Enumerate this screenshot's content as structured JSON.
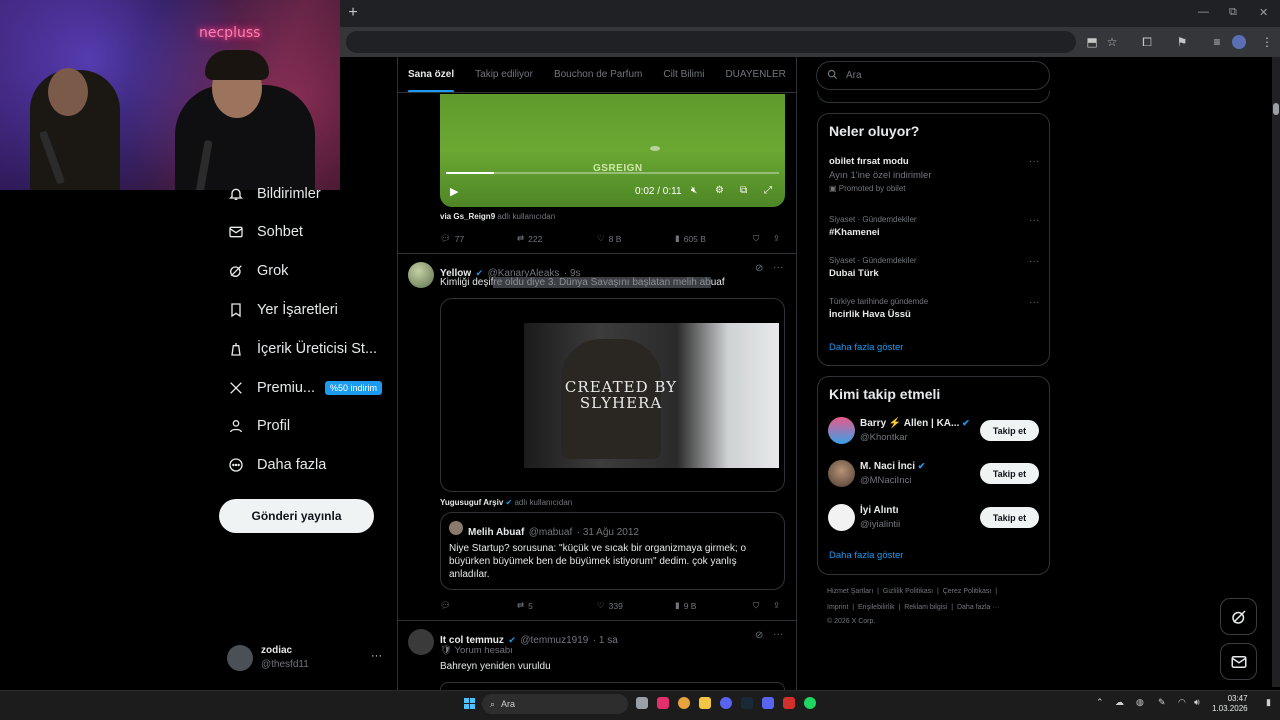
{
  "window": {
    "newtab": "+",
    "minimize": "—",
    "maximize": "⧉",
    "close": "✕"
  },
  "overlay": {
    "neon_text": "necpluss"
  },
  "nav": {
    "items": [
      {
        "label": "Bildirimler",
        "icon": "bell-icon"
      },
      {
        "label": "Sohbet",
        "icon": "mail-icon"
      },
      {
        "label": "Grok",
        "icon": "grok-icon"
      },
      {
        "label": "Yer İşaretleri",
        "icon": "bookmark-icon"
      },
      {
        "label": "İçerik Üreticisi St...",
        "icon": "creator-studio-icon"
      },
      {
        "label": "Premiu...",
        "icon": "x-logo-icon",
        "badge": "%50 indirim"
      },
      {
        "label": "Profil",
        "icon": "person-icon"
      },
      {
        "label": "Daha fazla",
        "icon": "more-circle-icon"
      }
    ],
    "post_button": "Gönderi yayınla",
    "account": {
      "name": "zodiac",
      "handle": "@thesfd11",
      "more": "···"
    }
  },
  "feed": {
    "tabs": [
      "Sana özel",
      "Takip ediliyor",
      "Bouchon de Parfum",
      "Cilt Bilimi",
      "DUAYENLER"
    ],
    "active_tab": 0,
    "post1": {
      "video_overlay_text": "GSREIGN",
      "time": "0:02 / 0:11",
      "via_user": "via Gs_Reign9",
      "via_suffix": "adlı kullanıcıdan",
      "replies": "77",
      "reposts": "222",
      "likes": "8 B",
      "views": "605 B"
    },
    "post2": {
      "name": "Yellow",
      "handle": "@KanaryAleaks",
      "time": "· 9s",
      "text_a": "Kimliği deşif",
      "text_b": "re oldu diye 3. Dünya Savaşını başlatan melih ab",
      "text_c": "uaf",
      "image_text_line1": "CREATED BY",
      "image_text_line2": "SLYHERA",
      "via_user": "Yugusuguf Arşiv",
      "via_suffix": "adlı kullanıcıdan",
      "quote": {
        "name": "Melih Abuaf",
        "handle": "@mabuaf",
        "date": "· 31 Ağu 2012",
        "text": "Niye Startup? sorusuna: \"küçük ve sıcak bir organizmaya girmek; o büyürken büyümek ben de büyümek istiyorum\" dedim. çok yanlış anladılar."
      },
      "reposts": "5",
      "likes": "339",
      "views": "9 B"
    },
    "post3": {
      "name": "It col temmuz",
      "handle": "@temmuz1919",
      "time": "· 1 sa",
      "subtitle": "Yorum hesabı",
      "text": "Bahreyn yeniden vuruldu"
    }
  },
  "right": {
    "search_placeholder": "Ara",
    "trends": {
      "title": "Neler oluyor?",
      "items": [
        {
          "meta": "",
          "title": "obilet fırsat modu",
          "sub": "Ayın 1'ine özel indirimler",
          "promo": "Promoted by obilet"
        },
        {
          "meta": "Siyaset · Gündemdekiler",
          "title": "#Khamenei"
        },
        {
          "meta": "Siyaset · Gündemdekiler",
          "title": "Dubai Türk"
        },
        {
          "meta": "Türkiye tarihinde gündemde",
          "title": "İncirlik Hava Üssü"
        }
      ],
      "more": "Daha fazla göster"
    },
    "who": {
      "title": "Kimi takip etmeli",
      "users": [
        {
          "name": "Barry ⚡ Allen | KA...",
          "handle": "@Khontkar",
          "button": "Takip et"
        },
        {
          "name": "M. Naci İnci",
          "handle": "@MNaciInci",
          "button": "Takip et"
        },
        {
          "name": "İyi Alıntı",
          "handle": "@iyialintii",
          "button": "Takip et"
        }
      ],
      "more": "Daha fazla göster"
    },
    "footer": {
      "line1": [
        "Hizmet Şartları",
        "Gizlilik Politikası",
        "Çerez Politikası"
      ],
      "line2": [
        "Imprint",
        "Erişilebilirlik",
        "Reklam bilgisi",
        "Daha fazla ···"
      ],
      "copyright": "© 2026 X Corp."
    }
  },
  "taskbar": {
    "search": "Ara",
    "time": "03:47",
    "date": "1.03.2026"
  }
}
